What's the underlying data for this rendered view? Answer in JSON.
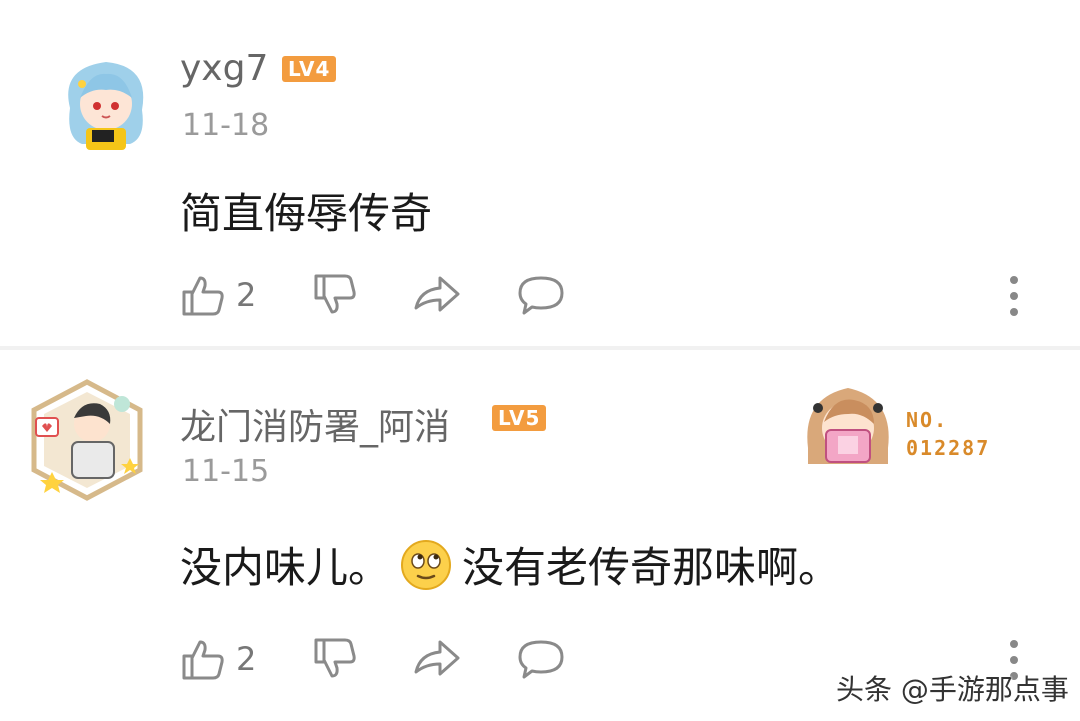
{
  "comments": [
    {
      "username": "yxg7",
      "level": "LV4",
      "date": "11-18",
      "text_before": "简直侮辱传奇",
      "text_after": "",
      "has_emoji": false,
      "likes": "2"
    },
    {
      "username": "龙门消防署_阿消",
      "level": "LV5",
      "date": "11-15",
      "text_before": "没内味儿。",
      "text_after": "没有老传奇那味啊。",
      "has_emoji": true,
      "likes": "2"
    }
  ],
  "badge": {
    "line1": "NO.",
    "line2": "012287"
  },
  "watermark": "头条 @手游那点事",
  "icons": {
    "like": "thumbs-up-icon",
    "dislike": "thumbs-down-icon",
    "share": "share-arrow-icon",
    "reply": "comment-bubble-icon",
    "more": "more-vertical-icon",
    "emoji": "rolling-eyes-emoji"
  },
  "colors": {
    "level_badge": "#f39c3f",
    "username": "#666666",
    "date": "#9a9a9a",
    "icon": "#8a8a8a"
  }
}
